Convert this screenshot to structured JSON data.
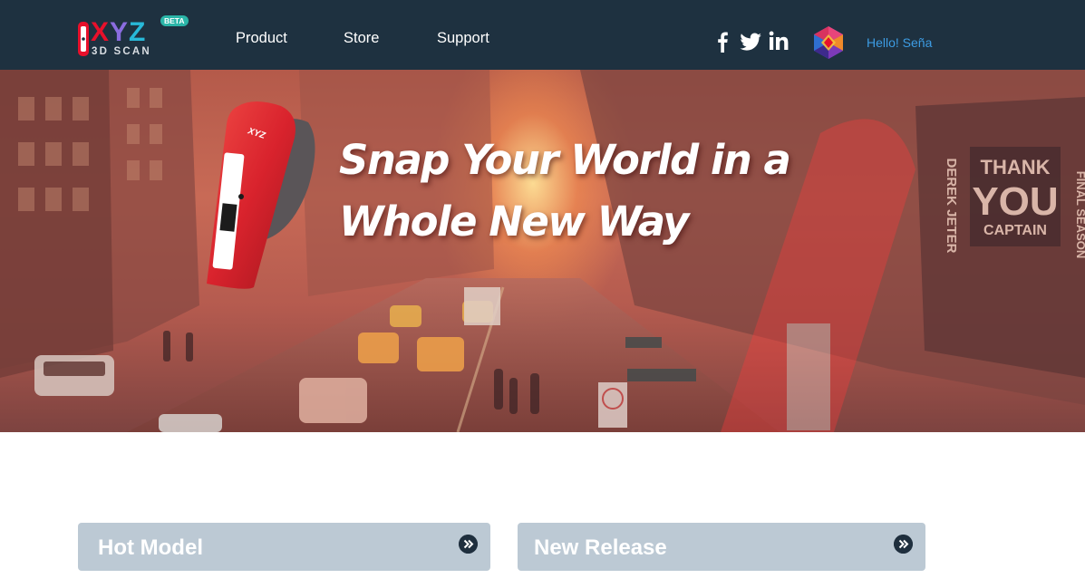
{
  "header": {
    "logo": {
      "brand": "XYZ",
      "subtitle": "3D SCAN",
      "badge": "BETA"
    },
    "nav": [
      {
        "label": "Product"
      },
      {
        "label": "Store"
      },
      {
        "label": "Support"
      }
    ],
    "social_icons": [
      "facebook-icon",
      "twitter-icon",
      "linkedin-icon"
    ],
    "user": {
      "avatar_icon": "colorful-polygon-avatar",
      "greeting": "Hello! Seña"
    }
  },
  "hero": {
    "headline_line1": "Snap Your World in a",
    "headline_line2": "Whole New Way",
    "signs": [
      "DEREK JETER",
      "THANK",
      "YOU",
      "CAPTAIN",
      "FINAL SEASON"
    ],
    "scanner_brand": "XYZ"
  },
  "sections": [
    {
      "label": "Hot Model",
      "icon": "double-chevron-right-icon"
    },
    {
      "label": "New Release",
      "icon": "double-chevron-right-icon"
    }
  ],
  "colors": {
    "header_bg": "#1e3140",
    "greeting": "#3d9ce3",
    "section_button_bg": "#bcc9d4",
    "scanner_red": "#d9232d",
    "beta_badge": "#2bb5a8"
  }
}
